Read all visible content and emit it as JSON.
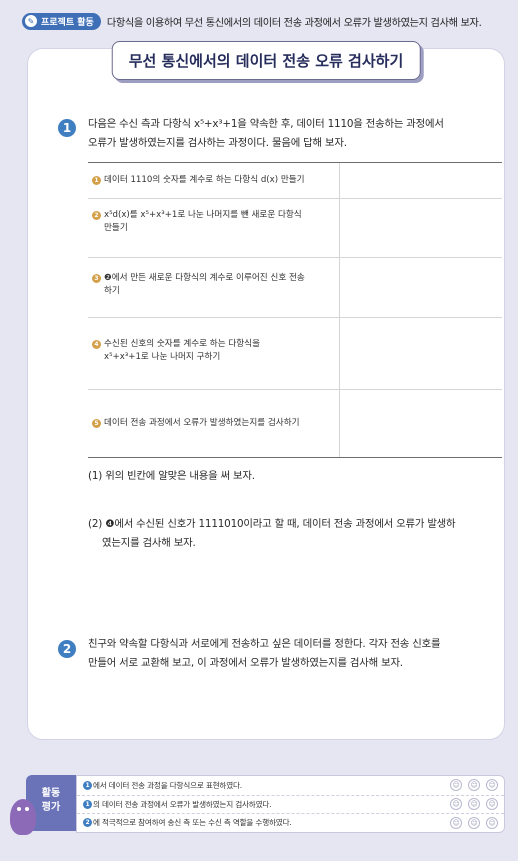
{
  "header": {
    "badge": "프로젝트 활동",
    "text": "다항식을 이용하여 무선 통신에서의 데이터 전송 과정에서 오류가 발생하였는지 검사해 보자."
  },
  "title": "무선 통신에서의 데이터 전송 오류 검사하기",
  "q1": {
    "num": "1",
    "line1": "다음은 수신 측과 다항식 x⁵+x³+1을 약속한 후, 데이터 1110을 전송하는 과정에서",
    "line2": "오류가 발생하였는지를 검사하는 과정이다. 물음에 답해 보자."
  },
  "table": {
    "rows": [
      {
        "num": "1",
        "line1": "데이터 1110의 숫자를 계수로 하는 다항식 d(x) 만들기",
        "line2": ""
      },
      {
        "num": "2",
        "line1": "x⁵d(x)를 x⁵+x³+1로 나눈 나머지를 뺀 새로운 다항식",
        "line2": "만들기"
      },
      {
        "num": "3",
        "line1": "❷에서 만든 새로운 다항식의 계수로 이루어진 신호 전송",
        "line2": "하기"
      },
      {
        "num": "4",
        "line1": "수신된 신호의 숫자를 계수로 하는 다항식을",
        "line2": "x⁵+x³+1로 나눈 나머지 구하기"
      },
      {
        "num": "5",
        "line1": "데이터 전송 과정에서 오류가 발생하였는지를 검사하기",
        "line2": ""
      }
    ]
  },
  "sub1": "(1) 위의 빈칸에 알맞은 내용을 써 보자.",
  "sub2_line1": "(2) ❹에서 수신된 신호가 1111010이라고 할 때, 데이터 전송 과정에서 오류가 발생하",
  "sub2_line2": "였는지를 검사해 보자.",
  "q2": {
    "num": "2",
    "line1": "친구와 약속할 다항식과 서로에게 전송하고 싶은 데이터를 정한다. 각자 전송 신호를",
    "line2": "만들어 서로 교환해 보고, 이 과정에서 오류가 발생하였는지를 검사해 보자."
  },
  "evaluation": {
    "label_line1": "활동",
    "label_line2": "평가",
    "items": [
      {
        "num": "1",
        "text": "에서 데이터 전송 과정을 다항식으로 표현하였다."
      },
      {
        "num": "1",
        "text": "의 데이터 전송 과정에서 오류가 발생하였는지 검사하였다."
      },
      {
        "num": "2",
        "text": "에 적극적으로 참여하여 송신 측 또는 수신 측 역할을 수행하였다."
      }
    ]
  }
}
